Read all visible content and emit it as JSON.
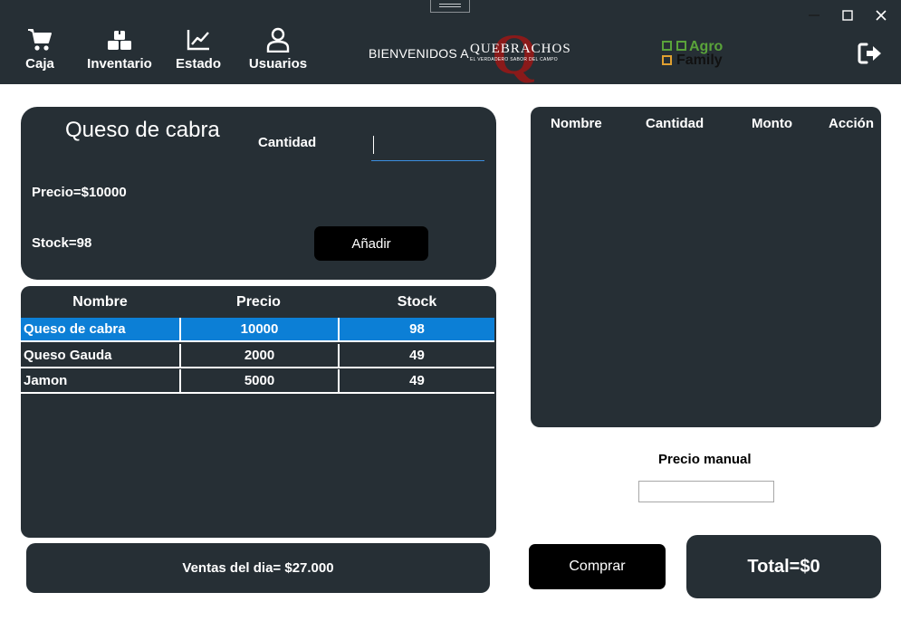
{
  "nav": [
    {
      "label": "Caja",
      "icon": "cart-icon"
    },
    {
      "label": "Inventario",
      "icon": "boxes-icon"
    },
    {
      "label": "Estado",
      "icon": "chart-icon"
    },
    {
      "label": "Usuarios",
      "icon": "user-icon"
    }
  ],
  "header": {
    "welcome": "BIENVENIDOS A",
    "brand_name": "QUEBRACHOS",
    "brand_tagline": "EL VERDADERO SABOR DEL CAMPO",
    "brand_letter": "Q",
    "partner_line1": "Agro",
    "partner_line2": "Family"
  },
  "detail": {
    "product_name": "Queso de cabra",
    "cantidad_label": "Cantidad",
    "cantidad_value": "",
    "precio_text": "Precio=$10000",
    "stock_text": "Stock=98",
    "add_button": "Añadir"
  },
  "inventory": {
    "columns": [
      "Nombre",
      "Precio",
      "Stock"
    ],
    "rows": [
      {
        "nombre": "Queso de cabra",
        "precio": "10000",
        "stock": "98",
        "selected": true
      },
      {
        "nombre": "Queso Gauda",
        "precio": "2000",
        "stock": "49",
        "selected": false
      },
      {
        "nombre": "Jamon",
        "precio": "5000",
        "stock": "49",
        "selected": false
      }
    ]
  },
  "ventas_text": "Ventas del dia= $27.000",
  "cart": {
    "columns": [
      "Nombre",
      "Cantidad",
      "Monto",
      "Acción"
    ]
  },
  "precio_manual": {
    "label": "Precio manual",
    "value": ""
  },
  "comprar_button": "Comprar",
  "total_text": "Total=$0",
  "colors": {
    "panel": "#262f35",
    "selected_row": "#0c7fd6",
    "brand_red": "#8a1a1a",
    "agro_green": "#5aa33a"
  }
}
